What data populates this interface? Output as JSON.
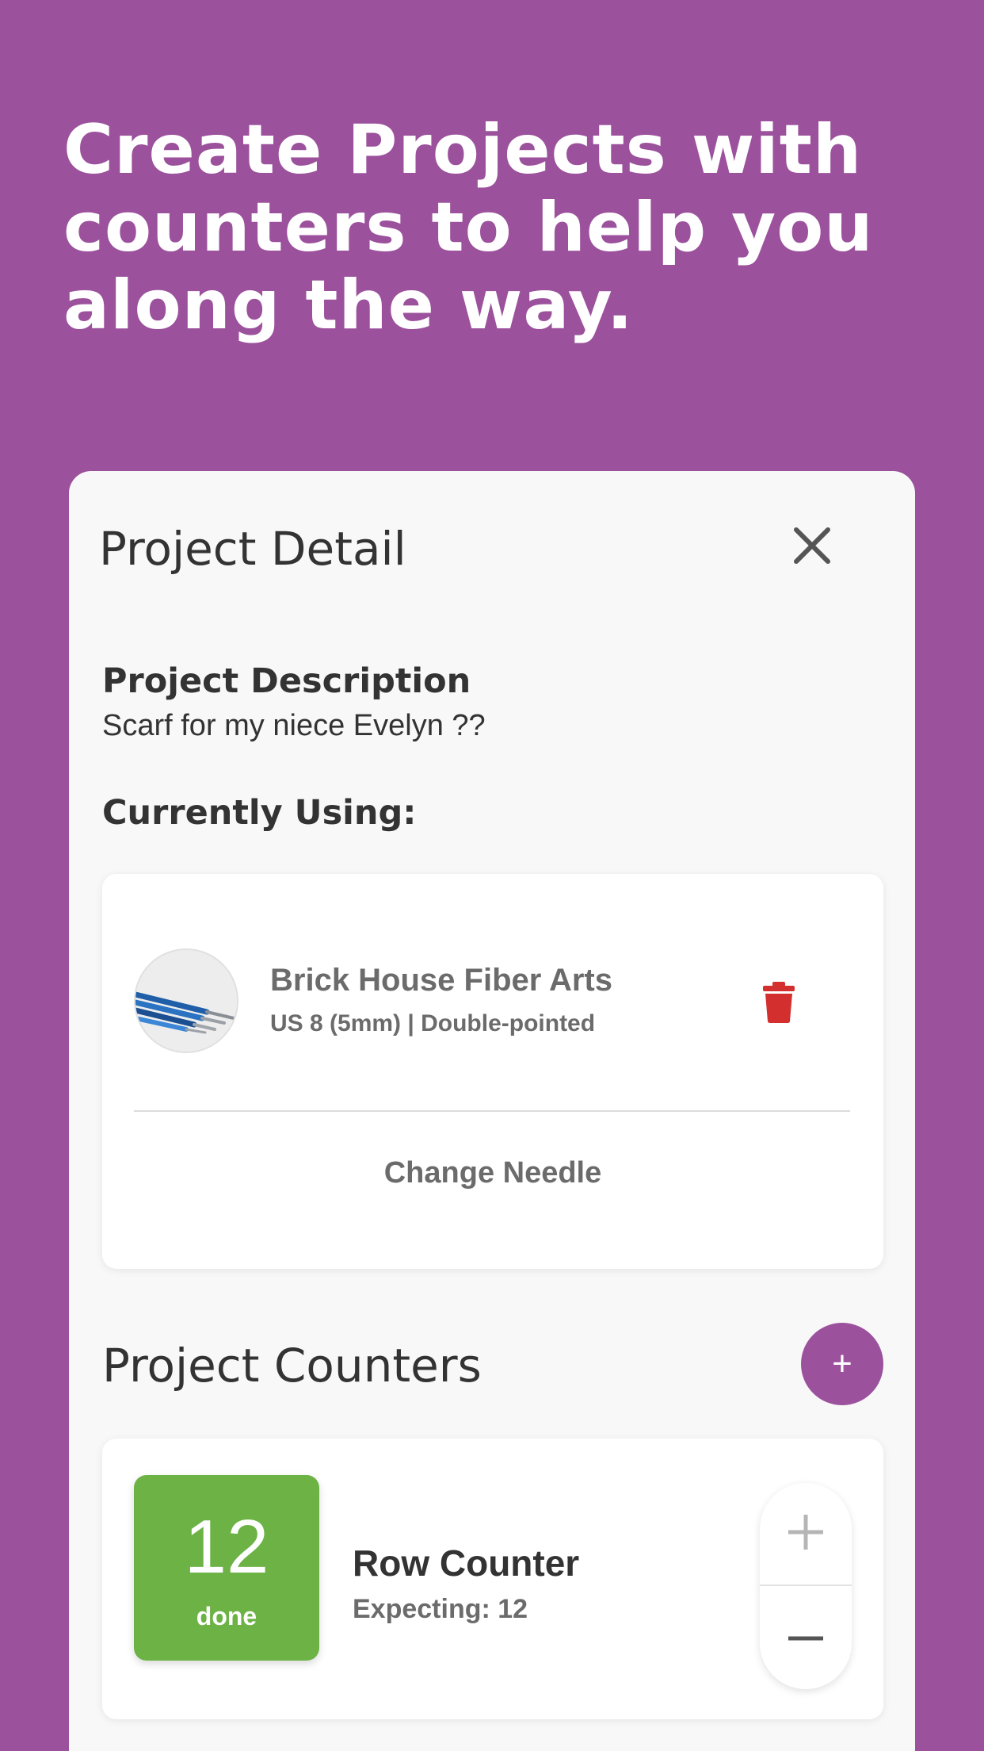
{
  "headline": "Create Projects with counters to help you along the way.",
  "sheet": {
    "title": "Project Detail",
    "description_label": "Project Description",
    "description_text": "Scarf for my niece Evelyn ??",
    "currently_using_label": "Currently Using:"
  },
  "needle": {
    "name": "Brick House Fiber Arts",
    "meta": "US 8 (5mm) | Double-pointed",
    "change_label": "Change Needle"
  },
  "counters": {
    "title": "Project Counters",
    "add_label": "+",
    "items": [
      {
        "value": "12",
        "status": "done",
        "name": "Row Counter",
        "expecting": "Expecting: 12"
      }
    ]
  },
  "colors": {
    "background": "#9b519c",
    "accent": "#9b519c",
    "done_green": "#6cb244",
    "delete_red": "#d32f2f"
  }
}
